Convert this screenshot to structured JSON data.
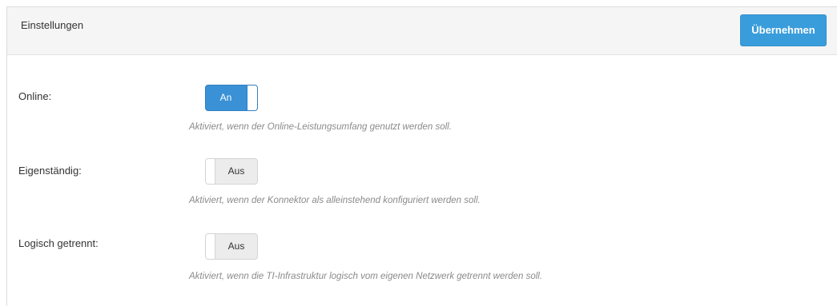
{
  "panel": {
    "title": "Einstellungen",
    "apply_label": "Übernehmen"
  },
  "settings": [
    {
      "label": "Online:",
      "state": "on",
      "toggle_text": "An",
      "help": "Aktiviert, wenn der Online-Leistungsumfang genutzt werden soll."
    },
    {
      "label": "Eigenständig:",
      "state": "off",
      "toggle_text": "Aus",
      "help": "Aktiviert, wenn der Konnektor als alleinstehend konfiguriert werden soll."
    },
    {
      "label": "Logisch getrennt:",
      "state": "off",
      "toggle_text": "Aus",
      "help": "Aktiviert, wenn die TI-Infrastruktur logisch vom eigenen Netzwerk getrennt werden soll."
    }
  ],
  "colors": {
    "accent": "#3a9ddb",
    "toggle_on": "#3a91d6",
    "toggle_off": "#ececec",
    "help_text": "#8a8a8a"
  }
}
